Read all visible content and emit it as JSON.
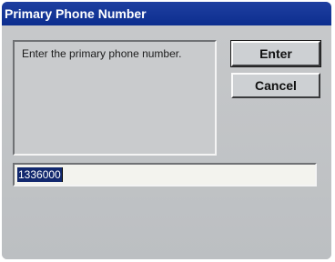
{
  "window": {
    "title": "Primary Phone Number"
  },
  "dialog": {
    "message": "Enter the primary phone number.",
    "buttons": {
      "enter_label": "Enter",
      "cancel_label": "Cancel"
    },
    "input": {
      "value": "1336000",
      "selected": true
    }
  },
  "colors": {
    "title_bar": "#0d2e8f",
    "title_text": "#ffffff",
    "dialog_background": "#c2c4c6",
    "input_background": "#f3f3ee",
    "selection_highlight": "#12286e"
  }
}
